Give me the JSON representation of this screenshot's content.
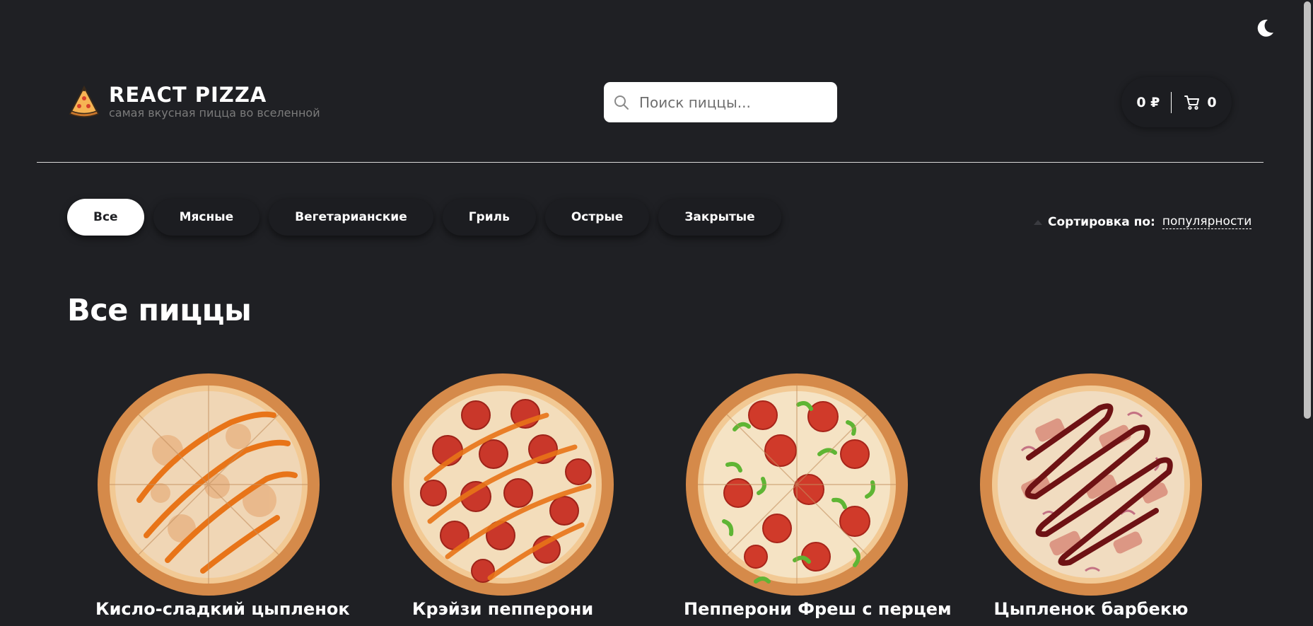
{
  "header": {
    "logo_title": "REACT PIZZA",
    "logo_subtitle": "самая вкусная пицца во вселенной",
    "search_placeholder": "Поиск пиццы...",
    "cart_price": "0 ₽",
    "cart_count": "0"
  },
  "categories": [
    {
      "label": "Все",
      "active": true
    },
    {
      "label": "Мясные",
      "active": false
    },
    {
      "label": "Вегетарианские",
      "active": false
    },
    {
      "label": "Гриль",
      "active": false
    },
    {
      "label": "Острые",
      "active": false
    },
    {
      "label": "Закрытые",
      "active": false
    }
  ],
  "sort": {
    "label": "Сортировка по:",
    "value": "популярности"
  },
  "page_title": "Все пиццы",
  "pizzas": [
    {
      "name": "Кисло-сладкий цыпленок",
      "style": "sweet-sour"
    },
    {
      "name": "Крэйзи пепперони",
      "style": "crazy-pepperoni"
    },
    {
      "name": "Пепперони Фреш с перцем",
      "style": "pepperoni-fresh"
    },
    {
      "name": "Цыпленок барбекю",
      "style": "bbq"
    }
  ],
  "icons": {
    "theme": "moon-icon",
    "logo": "pizza-slice-icon",
    "search": "search-icon",
    "cart": "cart-icon",
    "sort": "triangle-up-icon"
  },
  "colors": {
    "background": "#1f2024",
    "accent_active": "#ffffff",
    "chip_bg": "#1c1d21"
  }
}
